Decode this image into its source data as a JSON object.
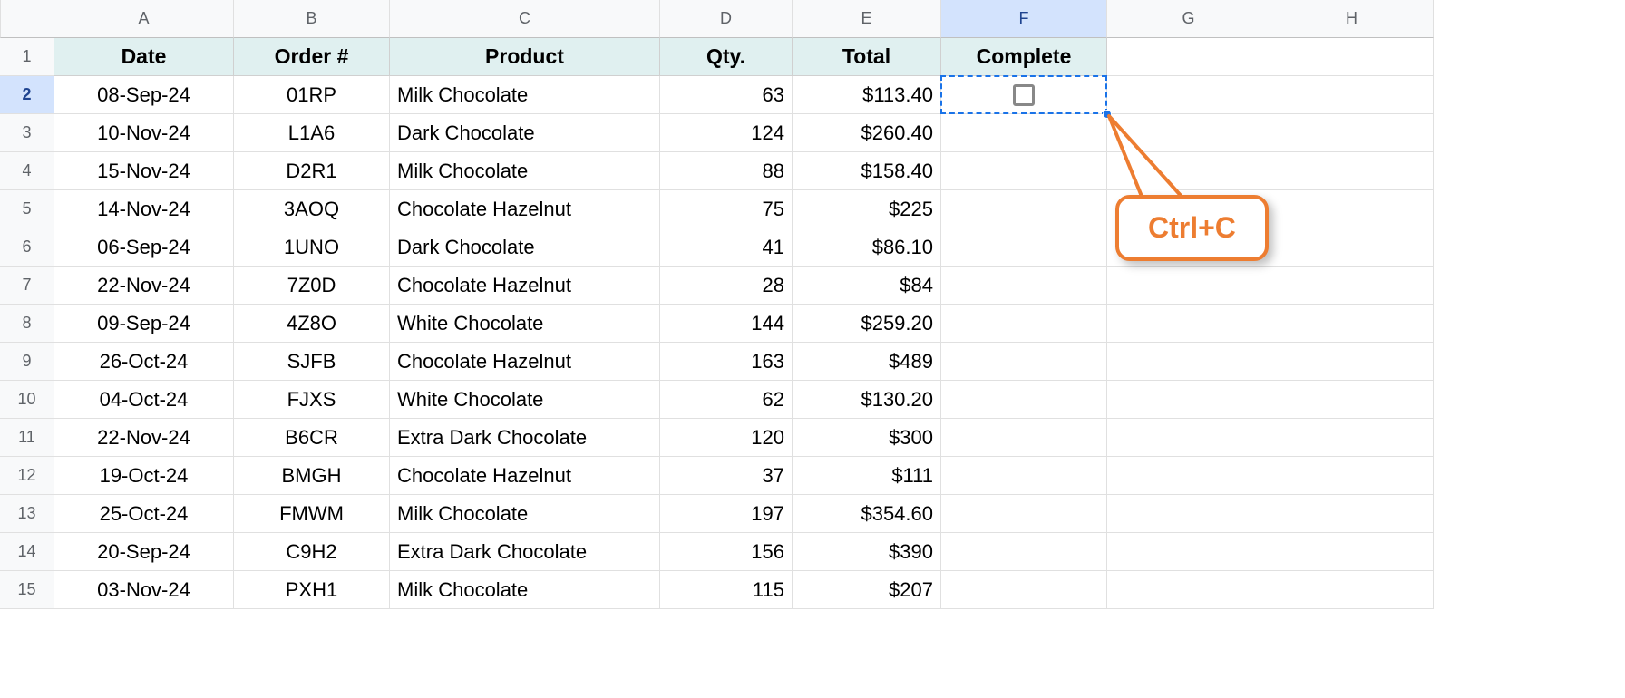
{
  "columns": [
    "A",
    "B",
    "C",
    "D",
    "E",
    "F",
    "G",
    "H"
  ],
  "selected_col": "F",
  "selected_row": 2,
  "headers": {
    "A": "Date",
    "B": "Order #",
    "C": "Product",
    "D": "Qty.",
    "E": "Total",
    "F": "Complete"
  },
  "rows": [
    {
      "n": 1
    },
    {
      "n": 2,
      "date": "08-Sep-24",
      "order": "01RP",
      "product": "Milk Chocolate",
      "qty": "63",
      "total": "$113.40",
      "complete": "checkbox"
    },
    {
      "n": 3,
      "date": "10-Nov-24",
      "order": "L1A6",
      "product": "Dark Chocolate",
      "qty": "124",
      "total": "$260.40"
    },
    {
      "n": 4,
      "date": "15-Nov-24",
      "order": "D2R1",
      "product": "Milk Chocolate",
      "qty": "88",
      "total": "$158.40"
    },
    {
      "n": 5,
      "date": "14-Nov-24",
      "order": "3AOQ",
      "product": "Chocolate Hazelnut",
      "qty": "75",
      "total": "$225"
    },
    {
      "n": 6,
      "date": "06-Sep-24",
      "order": "1UNO",
      "product": "Dark Chocolate",
      "qty": "41",
      "total": "$86.10"
    },
    {
      "n": 7,
      "date": "22-Nov-24",
      "order": "7Z0D",
      "product": "Chocolate Hazelnut",
      "qty": "28",
      "total": "$84"
    },
    {
      "n": 8,
      "date": "09-Sep-24",
      "order": "4Z8O",
      "product": "White Chocolate",
      "qty": "144",
      "total": "$259.20"
    },
    {
      "n": 9,
      "date": "26-Oct-24",
      "order": "SJFB",
      "product": "Chocolate Hazelnut",
      "qty": "163",
      "total": "$489"
    },
    {
      "n": 10,
      "date": "04-Oct-24",
      "order": "FJXS",
      "product": "White Chocolate",
      "qty": "62",
      "total": "$130.20"
    },
    {
      "n": 11,
      "date": "22-Nov-24",
      "order": "B6CR",
      "product": "Extra Dark Chocolate",
      "qty": "120",
      "total": "$300"
    },
    {
      "n": 12,
      "date": "19-Oct-24",
      "order": "BMGH",
      "product": "Chocolate Hazelnut",
      "qty": "37",
      "total": "$111"
    },
    {
      "n": 13,
      "date": "25-Oct-24",
      "order": "FMWM",
      "product": "Milk Chocolate",
      "qty": "197",
      "total": "$354.60"
    },
    {
      "n": 14,
      "date": "20-Sep-24",
      "order": "C9H2",
      "product": "Extra Dark Chocolate",
      "qty": "156",
      "total": "$390"
    },
    {
      "n": 15,
      "date": "03-Nov-24",
      "order": "PXH1",
      "product": "Milk Chocolate",
      "qty": "115",
      "total": "$207"
    }
  ],
  "callout": {
    "text": "Ctrl+C"
  }
}
